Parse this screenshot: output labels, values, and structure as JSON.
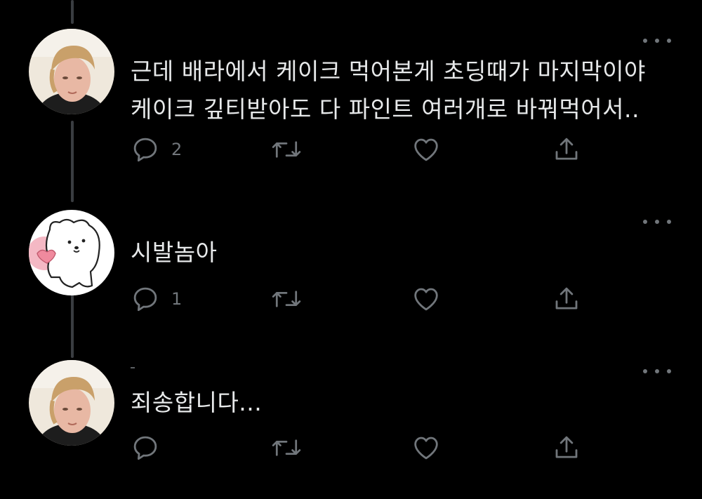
{
  "colors": {
    "background": "#000000",
    "text": "#e7e9ea",
    "icon": "#71767b",
    "thread_line": "#3a3d41"
  },
  "tweets": [
    {
      "text": "근데 배라에서 케이크 먹어본게 초딩때가 마지막이야 케이크 깊티받아도 다 파인트 여러개로 바꿔먹어서..",
      "reply_count": "2",
      "retweet_count": "",
      "like_count": "",
      "avatar": "user-photo-avatar"
    },
    {
      "text": "시발놈아",
      "reply_count": "1",
      "retweet_count": "",
      "like_count": "",
      "avatar": "white-bear-avatar"
    },
    {
      "text": "죄송합니다...",
      "reply_count": "",
      "retweet_count": "",
      "like_count": "",
      "avatar": "user-photo-avatar"
    }
  ],
  "icons": {
    "reply": "reply-icon",
    "retweet": "retweet-icon",
    "like": "heart-icon",
    "share": "share-icon",
    "more": "more-options-icon"
  }
}
